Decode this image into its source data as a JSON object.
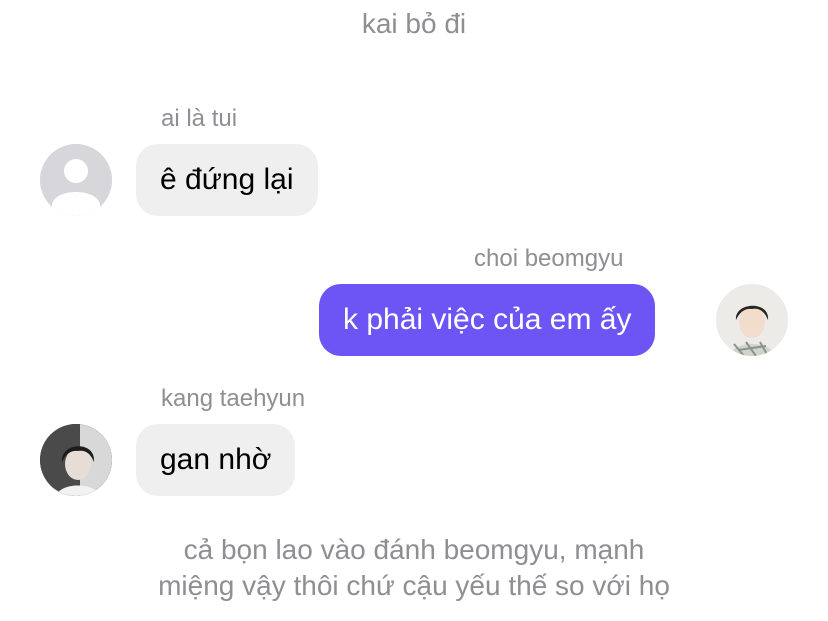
{
  "chat": {
    "top_note": "kai bỏ đi",
    "messages": [
      {
        "sender": "ai là tui",
        "text": "ê đứng lại",
        "direction": "incoming",
        "avatar": "default-profile-icon"
      },
      {
        "sender": "choi beomgyu",
        "text": "k phải việc của em ấy",
        "direction": "outgoing",
        "avatar": "profile-photo"
      },
      {
        "sender": "kang taehyun",
        "text": "gan nhờ",
        "direction": "incoming",
        "avatar": "profile-photo"
      }
    ],
    "bottom_note_lines": [
      "cả bọn lao vào đánh beomgyu, mạnh",
      "miệng vậy thôi chứ cậu yếu thế so với họ"
    ]
  },
  "colors": {
    "outgoing_bubble": "#6d55f5",
    "incoming_bubble": "#efefef",
    "meta_text": "#8e8e93"
  }
}
